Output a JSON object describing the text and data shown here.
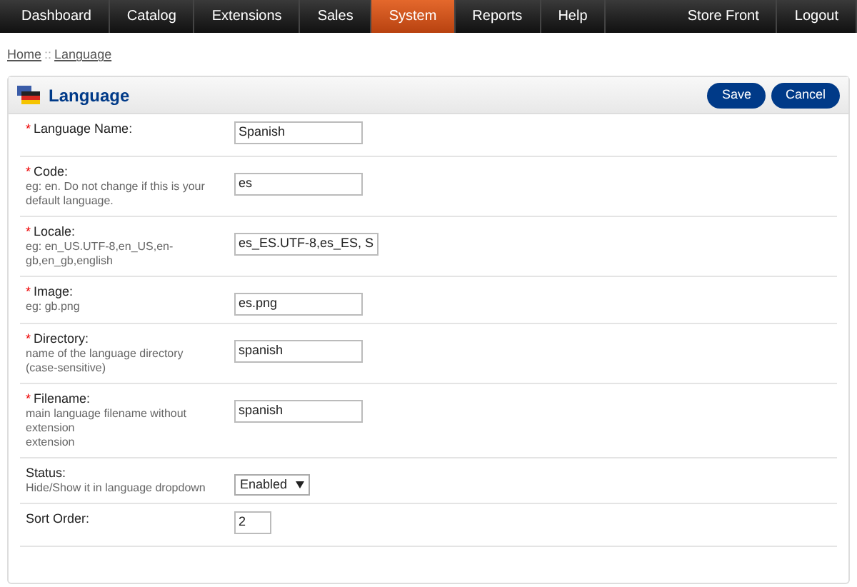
{
  "nav": {
    "left": [
      {
        "label": "Dashboard",
        "selected": false
      },
      {
        "label": "Catalog",
        "selected": false
      },
      {
        "label": "Extensions",
        "selected": false
      },
      {
        "label": "Sales",
        "selected": false
      },
      {
        "label": "System",
        "selected": true
      },
      {
        "label": "Reports",
        "selected": false
      },
      {
        "label": "Help",
        "selected": false
      }
    ],
    "right": [
      {
        "label": "Store Front",
        "selected": false
      },
      {
        "label": "Logout",
        "selected": false
      }
    ]
  },
  "breadcrumb": {
    "items": [
      "Home",
      "Language"
    ],
    "separator": "::"
  },
  "panel": {
    "title": "Language",
    "buttons": [
      "Save",
      "Cancel"
    ]
  },
  "rows": [
    {
      "marker": "*",
      "label": "Language Name:",
      "help": [],
      "kind": "text",
      "value": "Spanish"
    },
    {
      "marker": "*",
      "label": "Code:",
      "help": [
        "eg: en. Do not change if this is your default language."
      ],
      "kind": "text",
      "value": "es"
    },
    {
      "marker": "*",
      "label": "Locale:",
      "help": [
        "eg: en_US.UTF-8,en_US,en-gb,en_gb,english"
      ],
      "kind": "text",
      "value": "es_ES.UTF-8,es_ES, S"
    },
    {
      "marker": "*",
      "label": "Image:",
      "help": [
        "eg: gb.png"
      ],
      "kind": "text",
      "value": "es.png"
    },
    {
      "marker": "*",
      "label": "Directory:",
      "help": [
        "name of the language directory (case-sensitive)"
      ],
      "kind": "text",
      "value": "spanish"
    },
    {
      "marker": "*",
      "label": "Filename:",
      "help": [
        "main language filename without extension",
        "extension"
      ],
      "kind": "text",
      "value": "spanish"
    },
    {
      "label": "Status:",
      "help": [
        "Hide/Show it in language dropdown"
      ],
      "kind": "select",
      "value": "Enabled"
    },
    {
      "label": "Sort Order:",
      "help": [],
      "kind": "short",
      "value": "2"
    }
  ]
}
